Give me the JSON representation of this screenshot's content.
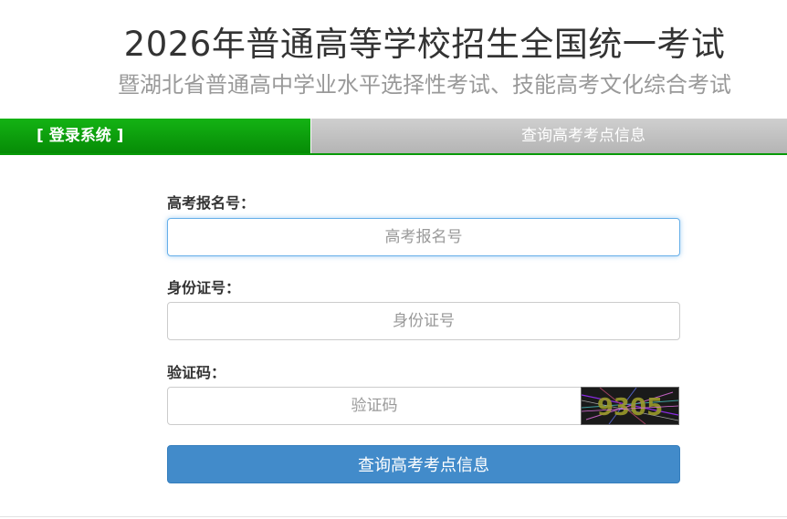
{
  "header": {
    "title": "2026年普通高等学校招生全国统一考试",
    "subtitle": "暨湖北省普通高中学业水平选择性考试、技能高考文化综合考试"
  },
  "tabs": {
    "login_label": "[ 登录系统 ]",
    "query_label": "查询高考考点信息"
  },
  "form": {
    "exam_no": {
      "label": "高考报名号：",
      "placeholder": "高考报名号",
      "value": ""
    },
    "id_no": {
      "label": "身份证号：",
      "placeholder": "身份证号",
      "value": ""
    },
    "captcha": {
      "label": "验证码：",
      "placeholder": "验证码",
      "value": "",
      "image_text": "9305"
    },
    "submit_label": "查询高考考点信息"
  },
  "colors": {
    "login_tab": "#079a07",
    "query_tab": "#bdbdbd",
    "submit": "#428bca",
    "focus_border": "#66afe9"
  }
}
